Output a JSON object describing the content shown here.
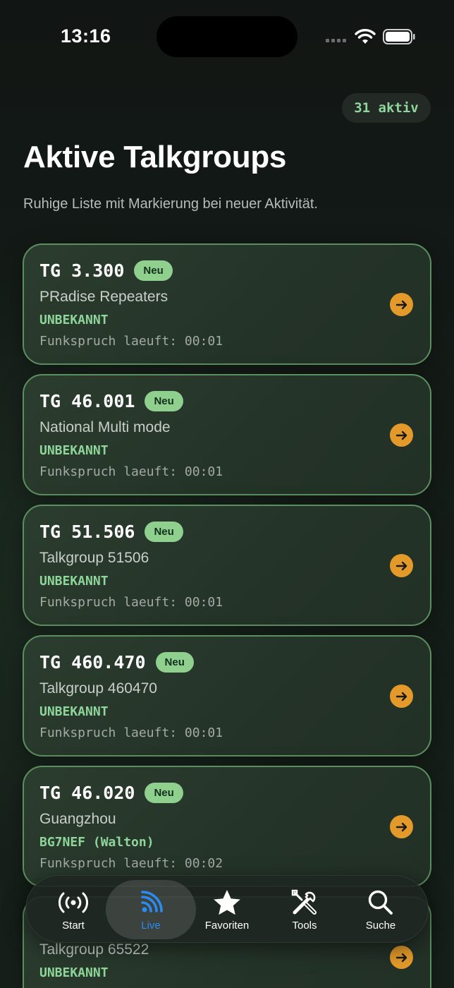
{
  "status_bar": {
    "time": "13:16"
  },
  "header": {
    "active_count": "31 aktiv",
    "title": "Aktive Talkgroups",
    "subtitle": "Ruhige Liste mit Markierung bei neuer Aktivität."
  },
  "talkgroups": [
    {
      "number": "TG 3.300",
      "badge": "Neu",
      "name": "PRadise Repeaters",
      "callsign": "UNBEKANNT",
      "status": "Funkspruch laeuft: 00:01"
    },
    {
      "number": "TG 46.001",
      "badge": "Neu",
      "name": "National Multi mode",
      "callsign": "UNBEKANNT",
      "status": "Funkspruch laeuft: 00:01"
    },
    {
      "number": "TG 51.506",
      "badge": "Neu",
      "name": "Talkgroup 51506",
      "callsign": "UNBEKANNT",
      "status": "Funkspruch laeuft: 00:01"
    },
    {
      "number": "TG 460.470",
      "badge": "Neu",
      "name": "Talkgroup 460470",
      "callsign": "UNBEKANNT",
      "status": "Funkspruch laeuft: 00:01"
    },
    {
      "number": "TG 46.020",
      "badge": "Neu",
      "name": "Guangzhou",
      "callsign": "BG7NEF (Walton)",
      "status": "Funkspruch laeuft: 00:02"
    },
    {
      "name": "Talkgroup 65522",
      "callsign": "UNBEKANNT"
    }
  ],
  "tab_bar": {
    "tabs": [
      {
        "label": "Start",
        "icon": "antenna-icon"
      },
      {
        "label": "Live",
        "icon": "live-waves-icon",
        "active": true
      },
      {
        "label": "Favoriten",
        "icon": "star-icon"
      },
      {
        "label": "Tools",
        "icon": "tools-icon"
      },
      {
        "label": "Suche",
        "icon": "search-icon"
      }
    ]
  },
  "colors": {
    "accent_green": "#8fd69a",
    "badge_green": "#8fd08f",
    "arrow_orange": "#e39a2a",
    "active_tab_blue": "#2a8cf0",
    "card_border": "#5c8f60"
  }
}
